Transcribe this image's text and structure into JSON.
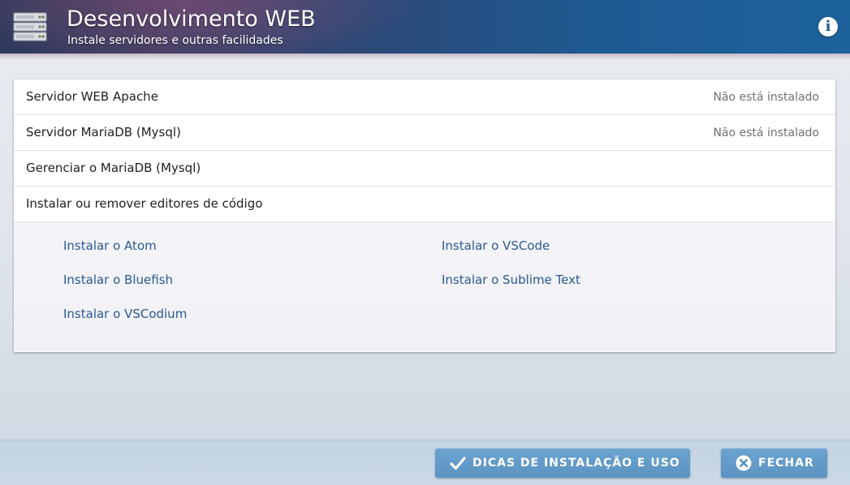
{
  "header": {
    "app_icon": "server-rack-icon",
    "title": "Desenvolvimento WEB",
    "subtitle": "Instale servidores e outras facilidades",
    "info_icon": "info-icon",
    "info_glyph": "i"
  },
  "rows": [
    {
      "label": "Servidor WEB Apache",
      "status": "Não está instalado"
    },
    {
      "label": "Servidor MariaDB (Mysql)",
      "status": "Não está instalado"
    },
    {
      "label": "Gerenciar o MariaDB (Mysql)",
      "status": ""
    },
    {
      "label": "Instalar ou remover editores de código",
      "status": ""
    }
  ],
  "editors": {
    "left": [
      "Instalar o Atom",
      "Instalar o Bluefish",
      "Instalar o VSCodium"
    ],
    "right": [
      "Instalar o VSCode",
      "Instalar o Sublime Text"
    ]
  },
  "footer": {
    "tips_label": "DICAS DE INSTALAÇÃO E USO",
    "tips_icon": "checkmark-icon",
    "close_label": "FECHAR",
    "close_icon": "close-circle-icon"
  },
  "colors": {
    "header_blue": "#1e5a92",
    "link": "#2a5a8f",
    "button": "#5b93c2"
  }
}
